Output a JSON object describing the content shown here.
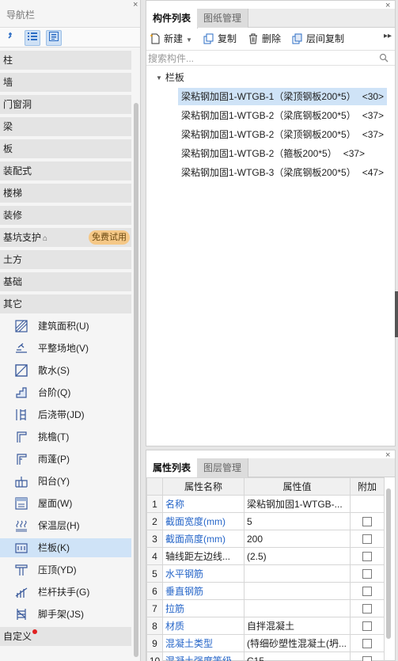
{
  "nav": {
    "title": "导航栏",
    "close": "×",
    "categories": [
      {
        "label": "柱"
      },
      {
        "label": "墙"
      },
      {
        "label": "门窗洞"
      },
      {
        "label": "梁"
      },
      {
        "label": "板"
      },
      {
        "label": "装配式"
      },
      {
        "label": "楼梯"
      },
      {
        "label": "装修"
      },
      {
        "label": "基坑支护",
        "lock": "⌂",
        "badge": "免费试用"
      },
      {
        "label": "土方"
      },
      {
        "label": "基础"
      },
      {
        "label": "其它"
      }
    ],
    "sub_items": [
      {
        "label": "建筑面积(U)",
        "icon": "building-area-icon"
      },
      {
        "label": "平整场地(V)",
        "icon": "site-leveling-icon"
      },
      {
        "label": "散水(S)",
        "icon": "apron-icon"
      },
      {
        "label": "台阶(Q)",
        "icon": "steps-icon"
      },
      {
        "label": "后浇带(JD)",
        "icon": "post-pour-strip-icon"
      },
      {
        "label": "挑檐(T)",
        "icon": "cornice-icon"
      },
      {
        "label": "雨蓬(P)",
        "icon": "canopy-icon"
      },
      {
        "label": "阳台(Y)",
        "icon": "balcony-icon"
      },
      {
        "label": "屋面(W)",
        "icon": "roof-icon"
      },
      {
        "label": "保温层(H)",
        "icon": "insulation-icon"
      },
      {
        "label": "栏板(K)",
        "icon": "parapet-icon",
        "selected": true
      },
      {
        "label": "压顶(YD)",
        "icon": "coping-icon"
      },
      {
        "label": "栏杆扶手(G)",
        "icon": "railing-icon"
      },
      {
        "label": "脚手架(JS)",
        "icon": "scaffold-icon"
      }
    ],
    "custom": {
      "label": "自定义"
    }
  },
  "components": {
    "tabs": [
      {
        "label": "构件列表",
        "active": true
      },
      {
        "label": "图纸管理",
        "active": false
      }
    ],
    "toolbar": {
      "new_label": "新建",
      "copy_label": "复制",
      "delete_label": "删除",
      "floor_copy_label": "层间复制",
      "more": "▸▸"
    },
    "search": {
      "placeholder": "搜索构件..."
    },
    "tree": {
      "root": "栏板",
      "items": [
        {
          "name": "梁粘钢加固1-WTGB-1（梁顶钢板200*5）",
          "qty": "<30>",
          "selected": true
        },
        {
          "name": "梁粘钢加固1-WTGB-2（梁底钢板200*5）",
          "qty": "<37>"
        },
        {
          "name": "梁粘钢加固1-WTGB-2（梁顶钢板200*5）",
          "qty": "<37>"
        },
        {
          "name": "梁粘钢加固1-WTGB-2（箍板200*5）",
          "qty": "<37>"
        },
        {
          "name": "梁粘钢加固1-WTGB-3（梁底钢板200*5）",
          "qty": "<47>"
        }
      ]
    }
  },
  "properties": {
    "tabs": [
      {
        "label": "属性列表",
        "active": true
      },
      {
        "label": "图层管理",
        "active": false
      }
    ],
    "headers": {
      "name": "属性名称",
      "value": "属性值",
      "extra": "附加"
    },
    "rows": [
      {
        "idx": "1",
        "name": "名称",
        "value": "梁粘钢加固1-WTGB-...",
        "blue": true,
        "checkbox": false
      },
      {
        "idx": "2",
        "name": "截面宽度(mm)",
        "value": "5",
        "blue": true,
        "checkbox": true
      },
      {
        "idx": "3",
        "name": "截面高度(mm)",
        "value": "200",
        "blue": true,
        "checkbox": true
      },
      {
        "idx": "4",
        "name": "轴线距左边线...",
        "value": "(2.5)",
        "blue": false,
        "checkbox": true
      },
      {
        "idx": "5",
        "name": "水平钢筋",
        "value": "",
        "blue": true,
        "checkbox": true
      },
      {
        "idx": "6",
        "name": "垂直钢筋",
        "value": "",
        "blue": true,
        "checkbox": true
      },
      {
        "idx": "7",
        "name": "拉筋",
        "value": "",
        "blue": true,
        "checkbox": true
      },
      {
        "idx": "8",
        "name": "材质",
        "value": "自拌混凝土",
        "blue": true,
        "checkbox": true
      },
      {
        "idx": "9",
        "name": "混凝土类型",
        "value": "(特细砂塑性混凝土(坍...",
        "blue": true,
        "checkbox": true
      },
      {
        "idx": "10",
        "name": "混凝土强度等级",
        "value": "C15",
        "blue": true,
        "checkbox": true
      }
    ]
  },
  "colors": {
    "accent": "#2565c8",
    "selection": "#cfe3f7",
    "badge": "#f5c887",
    "dot": "#e02020"
  }
}
